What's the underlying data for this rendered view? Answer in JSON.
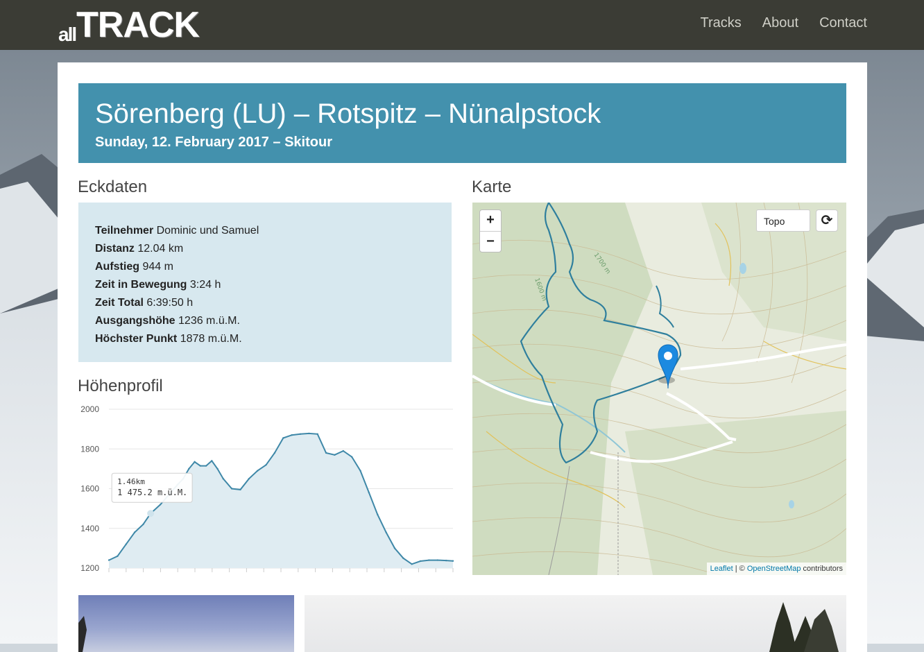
{
  "brand": {
    "logo_small": "all",
    "logo_big": "TRACK"
  },
  "nav": {
    "items": [
      "Tracks",
      "About",
      "Contact"
    ]
  },
  "hero": {
    "title": "Sörenberg (LU) – Rotspitz – Nünalpstock",
    "subtitle": "Sunday, 12. February 2017 – Skitour"
  },
  "sections": {
    "facts_title": "Eckdaten",
    "map_title": "Karte",
    "profile_title": "Höhenprofil"
  },
  "facts": [
    {
      "label": "Teilnehmer",
      "value": "Dominic und Samuel"
    },
    {
      "label": "Distanz",
      "value": "12.04 km"
    },
    {
      "label": "Aufstieg",
      "value": "944 m"
    },
    {
      "label": "Zeit in Bewegung",
      "value": "3:24 h"
    },
    {
      "label": "Zeit Total",
      "value": "6:39:50 h"
    },
    {
      "label": "Ausgangshöhe",
      "value": "1236 m.ü.M."
    },
    {
      "label": "Höchster Punkt",
      "value": "1878 m.ü.M."
    }
  ],
  "map": {
    "zoom_in": "+",
    "zoom_out": "−",
    "layer": "Topo",
    "reset_icon": "refresh-icon",
    "attribution_leaflet": "Leaflet",
    "attribution_sep": " | © ",
    "attribution_osm": "OpenStreetMap",
    "attribution_tail": " contributors",
    "contour_labels": [
      "1600 m",
      "1700 m"
    ]
  },
  "chart_data": {
    "type": "area",
    "title": "",
    "xlabel": "",
    "ylabel": "",
    "ylim": [
      1200,
      2000
    ],
    "yticks": [
      2000,
      1800,
      1600,
      1400,
      1200
    ],
    "x_km": [
      0,
      0.3,
      0.6,
      0.9,
      1.2,
      1.46,
      1.8,
      2.1,
      2.4,
      2.6,
      2.8,
      3.0,
      3.2,
      3.4,
      3.6,
      3.8,
      4.0,
      4.3,
      4.6,
      4.9,
      5.2,
      5.5,
      5.8,
      6.1,
      6.4,
      6.7,
      7.0,
      7.3,
      7.6,
      7.9,
      8.2,
      8.5,
      8.8,
      9.1,
      9.4,
      9.7,
      10.0,
      10.3,
      10.6,
      10.9,
      11.2,
      11.5,
      11.8,
      12.04
    ],
    "elevation": [
      1240,
      1260,
      1320,
      1380,
      1420,
      1475,
      1520,
      1570,
      1620,
      1650,
      1700,
      1735,
      1715,
      1715,
      1740,
      1700,
      1650,
      1600,
      1595,
      1650,
      1690,
      1720,
      1780,
      1855,
      1870,
      1875,
      1878,
      1875,
      1780,
      1770,
      1790,
      1760,
      1690,
      1580,
      1470,
      1380,
      1300,
      1250,
      1220,
      1235,
      1240,
      1240,
      1238,
      1236
    ],
    "tooltip": {
      "x_label": "1.46km",
      "y_label": "1 475.2 m.ü.M."
    },
    "colors": {
      "line": "#3f88a8",
      "fill": "#dfecf2",
      "grid": "#e6e6e6"
    }
  }
}
